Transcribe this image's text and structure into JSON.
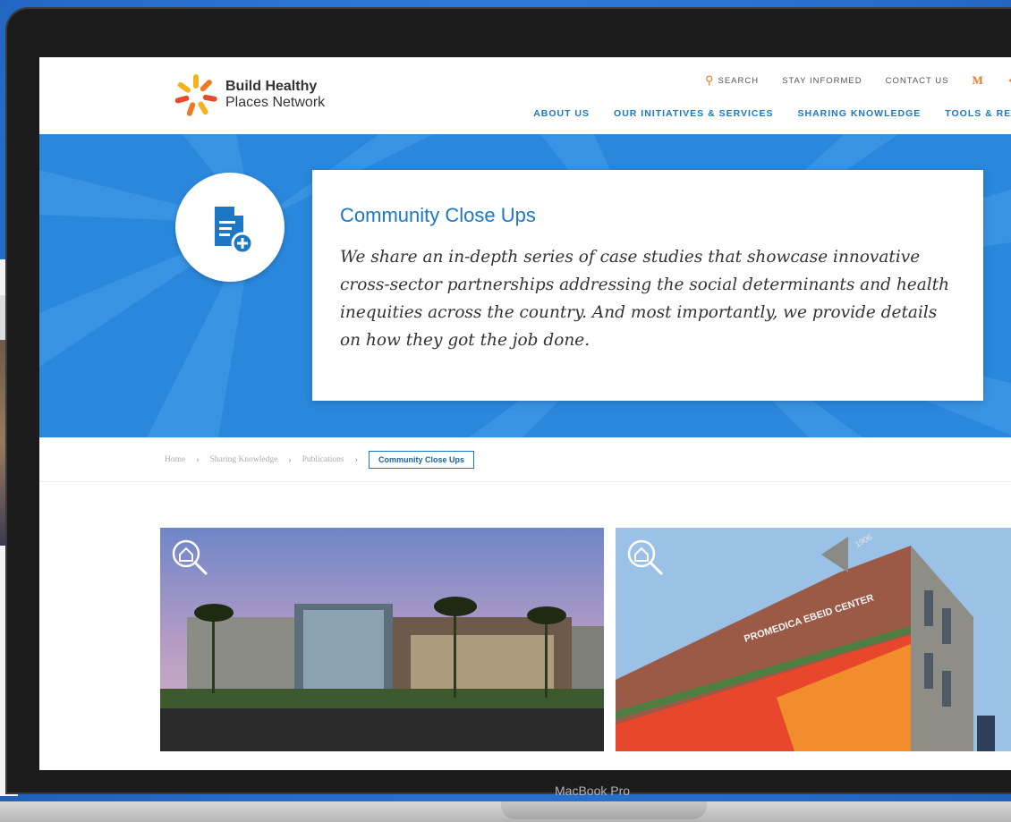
{
  "header": {
    "logo_line1": "Build Healthy",
    "logo_line2": "Places Network",
    "top_links": {
      "search": "SEARCH",
      "stay_informed": "STAY INFORMED",
      "contact_us": "CONTACT US",
      "medium_icon": "M"
    },
    "nav": [
      "ABOUT US",
      "OUR INITIATIVES & SERVICES",
      "SHARING KNOWLEDGE",
      "TOOLS & RESOU"
    ]
  },
  "hero": {
    "icon": "document-plus-icon",
    "title": "Community Close Ups",
    "text": "We share an in-depth series of case studies that showcase innovative cross-sector partnerships addressing the social determinants and health inequities across the country. And most importantly, we provide details on how they got the job done."
  },
  "breadcrumb": {
    "items": [
      "Home",
      "Sharing Knowledge",
      "Publications"
    ],
    "current": "Community Close Ups"
  },
  "cards": [
    {
      "icon": "home-search-icon"
    },
    {
      "icon": "home-search-icon",
      "sign_text": "PROMEDICA EBEID CENTER",
      "building_number": "1906"
    }
  ],
  "device_label": "MacBook Pro",
  "colors": {
    "brand_blue": "#1c77c4",
    "hero_blue": "#2a87dc",
    "accent_orange": "#f07a24"
  }
}
